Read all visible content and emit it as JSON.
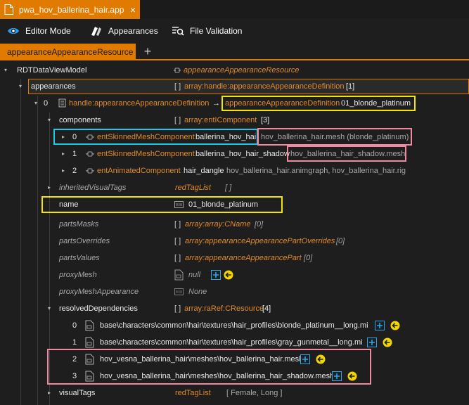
{
  "title_tab": {
    "label": "pwa_hov_ballerina_hair.app",
    "close": "×"
  },
  "toolbar": {
    "editor_mode": "Editor Mode",
    "appearances": "Appearances",
    "file_validation": "File Validation"
  },
  "resource_tabs": {
    "active": "appearanceAppearanceResource",
    "add": "+"
  },
  "tree": {
    "root": {
      "name": "RDTDataViewModel",
      "type": "appearanceAppearanceResource"
    },
    "appearances": {
      "name": "appearances",
      "brackets": "[ ]",
      "type": "array:handle:appearanceAppearanceDefinition",
      "count": "[1]"
    },
    "item0": {
      "index": "0",
      "handle_type": "handle:appearanceAppearanceDefinition",
      "arrow": "→",
      "def_type": "appearanceAppearanceDefinition",
      "def_name": "01_blonde_platinum"
    },
    "components": {
      "name": "components",
      "brackets": "[ ]",
      "type": "array:entIComponent",
      "count": "[3]",
      "items": [
        {
          "index": "0",
          "type": "entSkinnedMeshComponent",
          "name": "ballerina_hov_hair",
          "value": "hov_ballerina_hair.mesh (blonde_platinum)"
        },
        {
          "index": "1",
          "type": "entSkinnedMeshComponent",
          "name": "ballerina_hov_hair_shadow",
          "value": "hov_ballerina_hair_shadow.mesh"
        },
        {
          "index": "2",
          "type": "entAnimatedComponent",
          "name": "hair_dangle",
          "value": "hov_ballerina_hair.animgraph, hov_ballerina_hair.rig"
        }
      ]
    },
    "inheritedVisualTags": {
      "name": "inheritedVisualTags",
      "type": "redTagList",
      "value": "[ ]"
    },
    "name_field": {
      "name": "name",
      "value": "01_blonde_platinum"
    },
    "partsMasks": {
      "name": "partsMasks",
      "brackets": "[ ]",
      "type": "array:array:CName",
      "count": "[0]"
    },
    "partsOverrides": {
      "name": "partsOverrides",
      "brackets": "[ ]",
      "type": "array:appearanceAppearancePartOverrides",
      "count": "[0]"
    },
    "partsValues": {
      "name": "partsValues",
      "brackets": "[ ]",
      "type": "array:appearanceAppearancePart",
      "count": "[0]"
    },
    "proxyMesh": {
      "name": "proxyMesh",
      "value": "null"
    },
    "proxyMeshAppearance": {
      "name": "proxyMeshAppearance",
      "value": "None"
    },
    "resolvedDependencies": {
      "name": "resolvedDependencies",
      "brackets": "[ ]",
      "type": "array:raRef:CResource",
      "count": "[4]",
      "items": [
        {
          "index": "0",
          "path": "base\\characters\\common\\hair\\textures\\hair_profiles\\blonde_platinum__long.mi"
        },
        {
          "index": "1",
          "path": "base\\characters\\common\\hair\\textures\\hair_profiles\\gray_gunmetal__long.mi"
        },
        {
          "index": "2",
          "path": "hov_vesna_ballerina_hair\\meshes\\hov_ballerina_hair.mesh"
        },
        {
          "index": "3",
          "path": "hov_vesna_ballerina_hair\\meshes\\hov_ballerina_hair_shadow.mesh"
        }
      ]
    },
    "visualTags": {
      "name": "visualTags",
      "type": "redTagList",
      "value": "[ Female, Long ]"
    }
  },
  "colors": {
    "accent": "#e07b00",
    "type_text": "#e08a2e",
    "highlight_yellow": "#f2e600",
    "highlight_cyan": "#1ec8e8",
    "highlight_pink": "#f08aa0"
  },
  "icons": [
    "eye-icon",
    "appearances-icon",
    "file-validation-icon",
    "file-icon",
    "link-icon",
    "text-field-icon",
    "resource-file-icon",
    "add-file-icon",
    "back-arrow-icon"
  ]
}
